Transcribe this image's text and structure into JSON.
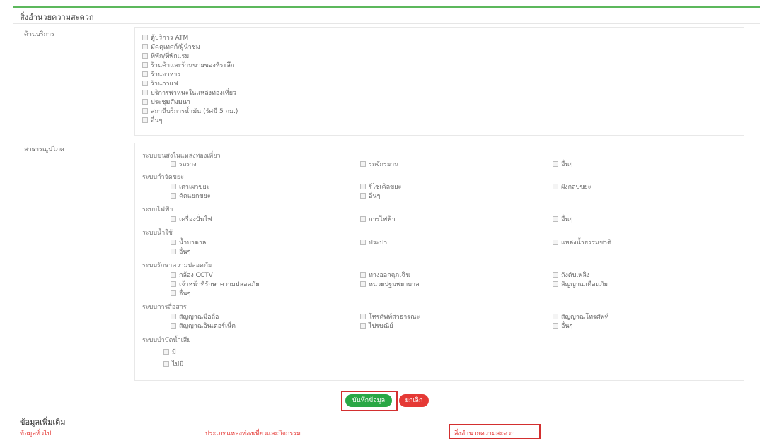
{
  "page": {
    "section_title": "สิ่งอำนวยความสะดวก",
    "services_label": "ด้านบริการ",
    "utilities_label": "สาธารณูปโภค"
  },
  "services": [
    "ตู้บริการ ATM",
    "มัคคุเทศก์/ผู้นำชม",
    "ที่พัก/ที่พักแรม",
    "ร้านค้าและร้านขายของที่ระลึก",
    "ร้านอาหาร",
    "ร้านกาแฟ",
    "บริการพาหนะในแหล่งท่องเที่ยว",
    "ประชุมสัมมนา",
    "สถานีบริการน้ำมัน (รัศมี 5 กม.)",
    "อื่นๆ"
  ],
  "utilities": {
    "transport": {
      "title": "ระบบขนส่งในแหล่งท่องเที่ยว",
      "items": [
        "รถราง",
        "รถจักรยาน",
        "อื่นๆ"
      ]
    },
    "waste": {
      "title": "ระบบกำจัดขยะ",
      "items": [
        "เตาเผาขยะ",
        "รีไซเคิลขยะ",
        "ฝังกลบขยะ",
        "คัดแยกขยะ",
        "อื่นๆ"
      ]
    },
    "electric": {
      "title": "ระบบไฟฟ้า",
      "items": [
        "เครื่องปั่นไฟ",
        "การไฟฟ้า",
        "อื่นๆ"
      ]
    },
    "water": {
      "title": "ระบบน้ำใช้",
      "items": [
        "น้ำบาดาล",
        "ประปา",
        "แหล่งน้ำธรรมชาติ",
        "อื่นๆ"
      ]
    },
    "safety": {
      "title": "ระบบรักษาความปลอดภัย",
      "items": [
        "กล้อง CCTV",
        "ทางออกฉุกเฉิน",
        "ถังดับเพลิง",
        "เจ้าหน้าที่รักษาความปลอดภัย",
        "หน่วยปฐมพยาบาล",
        "สัญญาณเตือนภัย",
        "อื่นๆ"
      ]
    },
    "comm": {
      "title": "ระบบการสื่อสาร",
      "items": [
        "สัญญาณมือถือ",
        "โทรศัพท์สาธารณะ",
        "สัญญาณโทรศัพท์",
        "สัญญาณอินเตอร์เน็ต",
        "ไปรษณีย์",
        "อื่นๆ"
      ]
    },
    "wastewater": {
      "title": "ระบบบำบัดน้ำเสีย",
      "items": [
        "มี",
        "ไม่มี"
      ]
    }
  },
  "buttons": {
    "save": "บันทึกข้อมูล",
    "cancel": "ยกเลิก"
  },
  "more": {
    "title": "ข้อมูลเพิ่มเติม",
    "links": [
      "ข้อมูลทั่วไป",
      "ประเภทแหล่งท่องเที่ยวและกิจกรรม",
      "สิ่งอำนวยความสะดวก"
    ]
  },
  "colors": {
    "accent_green": "#29a745",
    "cancel_red": "#e53935",
    "highlight_border": "#d32f2f",
    "link_red": "#e53935"
  }
}
